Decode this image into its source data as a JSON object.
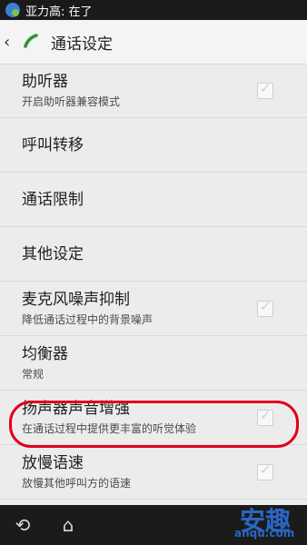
{
  "status_bar": {
    "text": "亚力高: 在了"
  },
  "action_bar": {
    "title": "通话设定"
  },
  "items": [
    {
      "label": "助听器",
      "sub": "开启助听器兼容模式",
      "has_checkbox": true
    },
    {
      "label": "呼叫转移",
      "sub": "",
      "has_checkbox": false
    },
    {
      "label": "通话限制",
      "sub": "",
      "has_checkbox": false
    },
    {
      "label": "其他设定",
      "sub": "",
      "has_checkbox": false
    },
    {
      "label": "麦克风噪声抑制",
      "sub": "降低通话过程中的背景噪声",
      "has_checkbox": true
    },
    {
      "label": "均衡器",
      "sub": "常规",
      "has_checkbox": false
    },
    {
      "label": "扬声器声音增强",
      "sub": "在通话过程中提供更丰富的听觉体验",
      "has_checkbox": true
    },
    {
      "label": "放慢语速",
      "sub": "放慢其他呼叫方的语速",
      "has_checkbox": true
    }
  ],
  "navigation": {
    "back_icon": "back-arrow-icon",
    "home_icon": "home-icon"
  },
  "watermark": {
    "big": "安趣",
    "small": "anqu.com"
  },
  "colors": {
    "highlight": "#e0001b",
    "accent": "#2a66c4"
  }
}
